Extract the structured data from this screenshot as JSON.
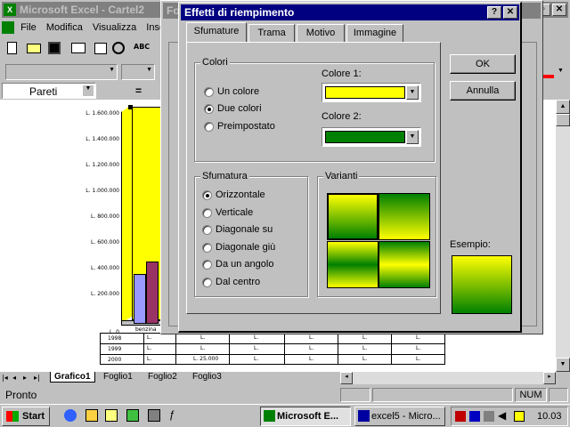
{
  "excel": {
    "title": "Microsoft Excel - Cartel2",
    "menu": [
      "File",
      "Modifica",
      "Visualizza",
      "Inse"
    ],
    "namebox": "Pareti",
    "formula_eq": "=",
    "sheet_tabs": [
      "Grafico1",
      "Foglio1",
      "Foglio2",
      "Foglio3"
    ],
    "status": "Pronto",
    "num": "NUM",
    "chart": {
      "y_ticks": [
        "L. 1.600.000",
        "L. 1.400.000",
        "L. 1.200.000",
        "L. 1.000.000",
        "L. 800.000",
        "L. 600.000",
        "L. 400.000",
        "L. 200.000",
        "L. 0"
      ],
      "category": "benzina",
      "rows": [
        {
          "label": "1998",
          "cells": [
            "L.",
            "L.",
            "L.",
            "L.",
            "L.",
            "L."
          ]
        },
        {
          "label": "1999",
          "cells": [
            "L.",
            "L.",
            "L.",
            "L.",
            "L.",
            "L."
          ]
        },
        {
          "label": "2000",
          "cells": [
            "L.",
            "L. 25.000",
            "L.",
            "L.",
            "L.",
            "L."
          ]
        }
      ]
    }
  },
  "background_dialog_title": "Fo",
  "dialog": {
    "title": "Effetti di riempimento",
    "tabs": [
      "Sfumature",
      "Trama",
      "Motivo",
      "Immagine"
    ],
    "colors_group": "Colori",
    "color_options": [
      {
        "label": "Un colore",
        "selected": false
      },
      {
        "label": "Due colori",
        "selected": true
      },
      {
        "label": "Preimpostato",
        "selected": false
      }
    ],
    "color1_label": "Colore 1:",
    "color1_value": "#ffff00",
    "color2_label": "Colore 2:",
    "color2_value": "#008000",
    "shading_group": "Sfumatura",
    "shading_options": [
      {
        "label": "Orizzontale",
        "selected": true
      },
      {
        "label": "Verticale",
        "selected": false
      },
      {
        "label": "Diagonale su",
        "selected": false
      },
      {
        "label": "Diagonale giù",
        "selected": false
      },
      {
        "label": "Da un angolo",
        "selected": false
      },
      {
        "label": "Dal centro",
        "selected": false
      }
    ],
    "variants_group": "Varianti",
    "sample_label": "Esempio:",
    "ok": "OK",
    "cancel": "Annulla"
  },
  "taskbar": {
    "start": "Start",
    "tasks": [
      "Microsoft E...",
      "excel5 - Micro..."
    ],
    "clock": "10.03"
  }
}
